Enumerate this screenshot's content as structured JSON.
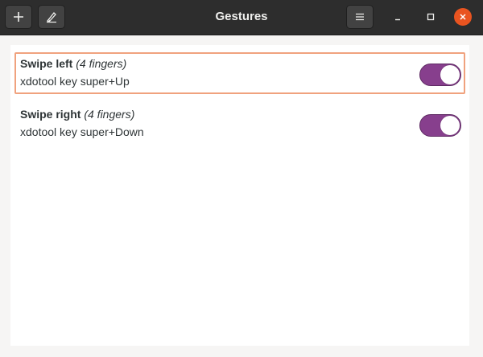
{
  "window": {
    "title": "Gestures"
  },
  "header": {
    "add_icon": "plus-icon",
    "edit_icon": "edit-clear-icon",
    "menu_icon": "hamburger-menu-icon"
  },
  "gestures": [
    {
      "name": "Swipe left",
      "fingers": "(4 fingers)",
      "command": "xdotool key super+Up",
      "enabled": true,
      "focused": true
    },
    {
      "name": "Swipe right",
      "fingers": "(4 fingers)",
      "command": "xdotool key super+Down",
      "enabled": true,
      "focused": false
    }
  ],
  "colors": {
    "headerbar": "#2d2d2d",
    "switch_on": "#873f8d",
    "close_button": "#e95420",
    "focus_ring": "#f0a27e"
  }
}
